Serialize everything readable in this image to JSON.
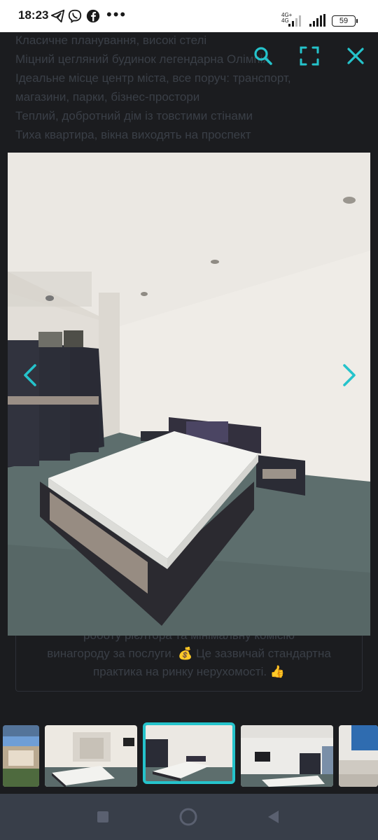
{
  "status_bar": {
    "time": "18:23",
    "network_label_top": "4G+",
    "network_label_bottom": "4G",
    "battery": "59",
    "icons": [
      "telegram-icon",
      "viber-icon",
      "facebook-icon",
      "more-dots-icon",
      "signal-icon",
      "wifi-signal-icon",
      "battery-icon"
    ],
    "more": "•••"
  },
  "background_listing": {
    "lines": [
      "Класичне планування, високі стелі",
      "Міцний цегляний будинок легендарна Олімпія",
      "Ідеальне місце центр міста, все поруч: транспорт,",
      "магазини, парки, бізнес-простори",
      "Теплий, добротний дім із товстими стінами",
      "Тиха квартира, вікна виходять на проспект"
    ],
    "card_lines": [
      "роботу рієлтора та мінімальну комісію",
      "винагороду за послуги. 💰 Це зазвичай стандартна",
      "практика на ринку нерухомості. 👍"
    ]
  },
  "viewer": {
    "top_icons": [
      "search-icon",
      "fullscreen-icon",
      "close-icon"
    ],
    "accent_color": "#25c3cb",
    "photo_subject": "bedroom with bed and wardrobe",
    "arrows": [
      "chevron-left-icon",
      "chevron-right-icon"
    ],
    "thumbnails_count": 5,
    "active_thumbnail": 3
  },
  "navigation_bar": {
    "buttons": [
      "recent-apps-icon",
      "home-icon",
      "back-icon"
    ],
    "color": "#383e49"
  }
}
